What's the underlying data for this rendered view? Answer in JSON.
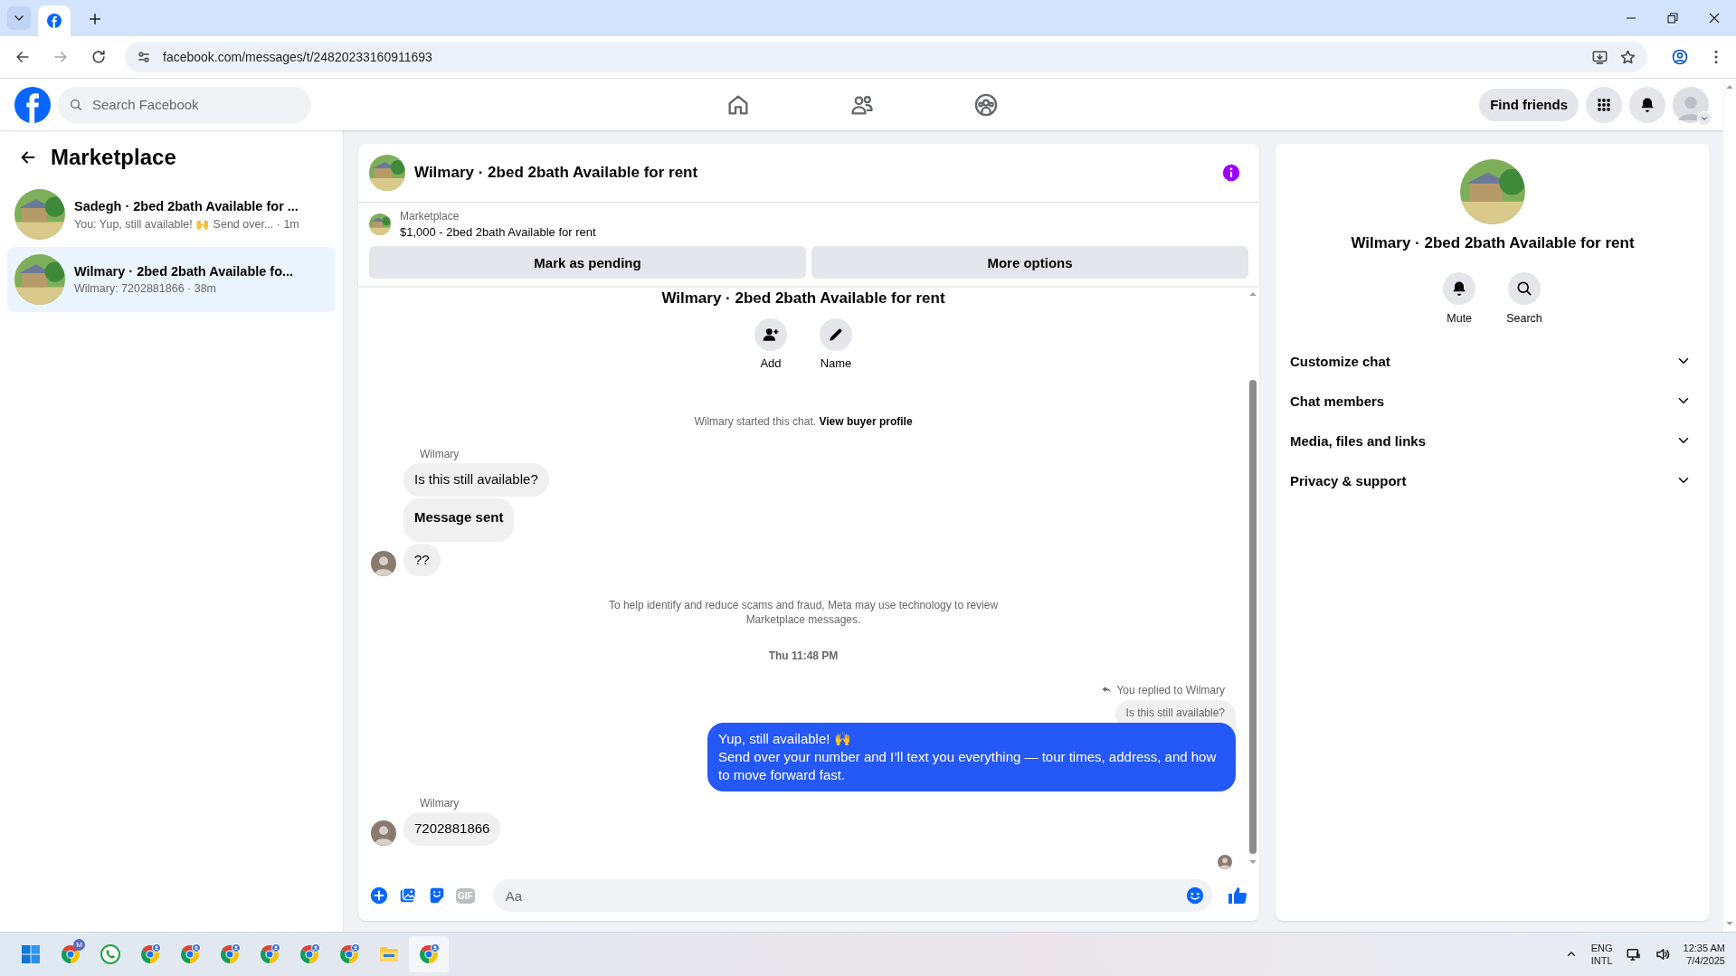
{
  "browser": {
    "url": "facebook.com/messages/t/24820233160911693"
  },
  "header": {
    "search": {
      "placeholder": "Search Facebook"
    },
    "find_friends": "Find friends"
  },
  "sidebar": {
    "title": "Marketplace",
    "conversations": [
      {
        "title": "Sadegh · 2bed 2bath Available for ...",
        "preview": "You: Yup, still available! 🙌 Send over... · 1m",
        "selected": false
      },
      {
        "title": "Wilmary · 2bed 2bath Available fo...",
        "preview": "Wilmary: 7202881866 · 38m",
        "selected": true
      }
    ]
  },
  "chat": {
    "title": "Wilmary · 2bed 2bath Available for rent",
    "listing": {
      "label": "Marketplace",
      "text": "$1,000 - 2bed 2bath Available for rent"
    },
    "actions": [
      "Mark as pending",
      "More options"
    ],
    "intro": {
      "title": "Wilmary · 2bed 2bath Available for rent",
      "buttons": [
        {
          "kind": "add",
          "label": "Add"
        },
        {
          "kind": "name",
          "label": "Name"
        }
      ]
    },
    "started": {
      "text": "Wilmary started this chat.",
      "link": "View buyer profile"
    },
    "messages": [
      {
        "kind": "sender",
        "text": "Wilmary"
      },
      {
        "kind": "incoming",
        "text": "Is this still available?",
        "avatar": false,
        "bold": false
      },
      {
        "kind": "incoming",
        "text": "Message sent",
        "avatar": false,
        "bold": true
      },
      {
        "kind": "incoming",
        "text": "??",
        "avatar": true,
        "bold": false
      },
      {
        "kind": "notice",
        "text": "To help identify and reduce scams and fraud, Meta may use technology to review Marketplace messages."
      },
      {
        "kind": "timestamp",
        "text": "Thu 11:48 PM"
      },
      {
        "kind": "reply_label",
        "text": "You replied to Wilmary"
      },
      {
        "kind": "quoted",
        "text": "Is this still available?"
      },
      {
        "kind": "outgoing",
        "text": "Yup, still available! 🙌\nSend over your number and I’ll text you everything — tour times, address, and how to move forward fast."
      },
      {
        "kind": "sender",
        "text": "Wilmary"
      },
      {
        "kind": "incoming",
        "text": "7202881866",
        "avatar": true,
        "bold": false
      }
    ],
    "composer": {
      "gif_label": "GIF",
      "placeholder": "Aa"
    }
  },
  "info": {
    "title": "Wilmary · 2bed 2bath Available for rent",
    "actions": [
      {
        "kind": "mute",
        "label": "Mute"
      },
      {
        "kind": "search",
        "label": "Search"
      }
    ],
    "sections": [
      {
        "label": "Customize chat",
        "expanded": false
      },
      {
        "label": "Chat members",
        "expanded": false
      },
      {
        "label": "Media, files and links",
        "expanded": false
      },
      {
        "label": "Privacy & support",
        "expanded": false
      }
    ]
  },
  "taskbar": {
    "badge": "M",
    "language": "ENG",
    "layout": "INTL",
    "time": "12:35 AM",
    "date": "7/4/2025"
  }
}
